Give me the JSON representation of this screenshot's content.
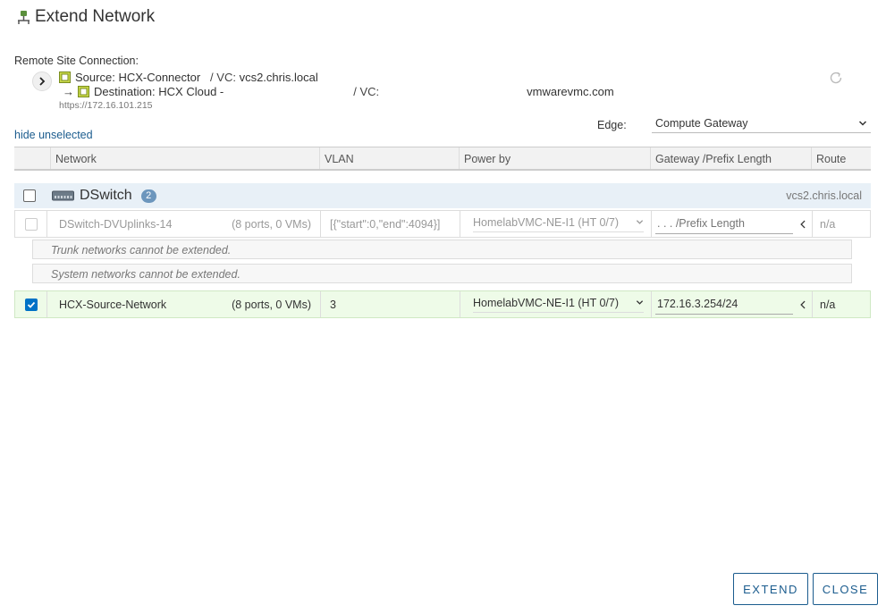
{
  "dialog": {
    "title": "Extend Network"
  },
  "remote": {
    "label": "Remote Site Connection:",
    "source_prefix": "Source: ",
    "source_name": "HCX-Connector",
    "source_vc_label": "/   VC: ",
    "source_vc": "vcs2.chris.local",
    "dest_arrow": "→",
    "dest_prefix": "Destination: ",
    "dest_name": "HCX Cloud -",
    "dest_vc_label": "/   VC:",
    "dest_vc": "vmwarevmc.com",
    "url": "https://172.16.101.215"
  },
  "edge": {
    "label": "Edge:",
    "value": "Compute Gateway"
  },
  "hide_link": "hide unselected",
  "table": {
    "columns": [
      "Network",
      "VLAN",
      "Power by",
      "Gateway /Prefix Length",
      "Route"
    ],
    "group": {
      "name": "DSwitch",
      "count": "2",
      "vc": "vcs2.chris.local"
    },
    "rows": [
      {
        "name": "DSwitch-DVUplinks-14",
        "ports": "(8 ports, 0 VMs)",
        "vlan": "[{\"start\":0,\"end\":4094}]",
        "power": "HomelabVMC-NE-I1 (HT 0/7)",
        "gateway_placeholder": ". . . /Prefix Length",
        "gateway_value": "",
        "route": "n/a"
      },
      {
        "name": "HCX-Source-Network",
        "ports": "(8 ports, 0 VMs)",
        "vlan": "3",
        "power": "HomelabVMC-NE-I1 (HT 0/7)",
        "gateway_placeholder": "",
        "gateway_value": "172.16.3.254/24",
        "route": "n/a"
      }
    ],
    "notices": [
      "Trunk networks cannot be extended.",
      "System networks cannot be extended."
    ]
  },
  "buttons": {
    "extend": "EXTEND",
    "close": "CLOSE"
  },
  "colors": {
    "accent": "#1b5c8e",
    "checkbox": "#0072c6",
    "selected_row": "#eefbe8",
    "group_row": "#e8f0f7"
  }
}
